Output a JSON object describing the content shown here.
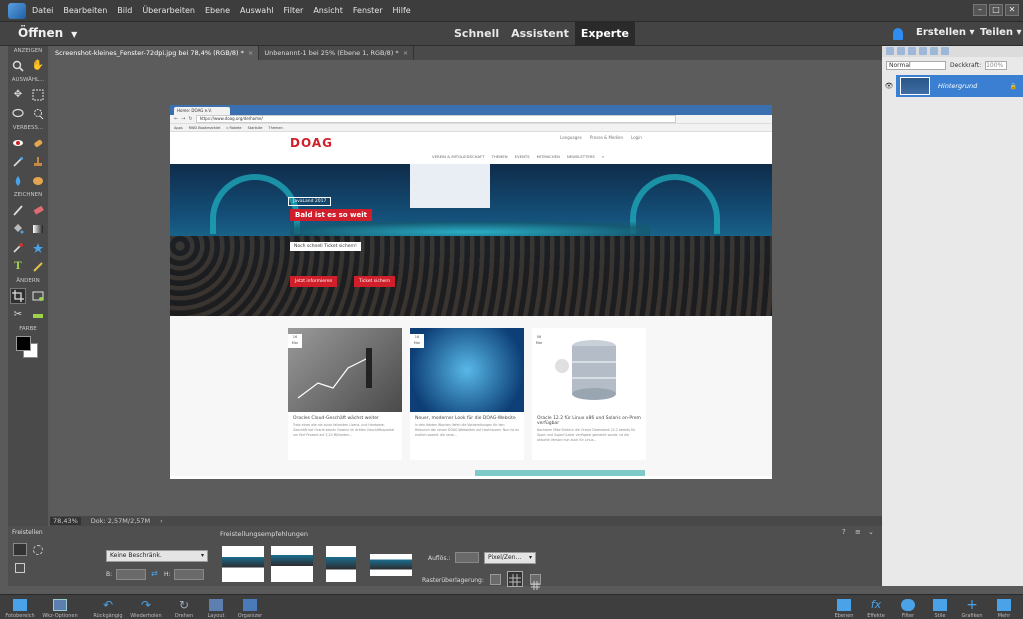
{
  "menu": [
    "Datei",
    "Bearbeiten",
    "Bild",
    "Überarbeiten",
    "Ebene",
    "Auswahl",
    "Filter",
    "Ansicht",
    "Fenster",
    "Hilfe"
  ],
  "modebar": {
    "open_label": "Öffnen",
    "modes": [
      "Schnell",
      "Assistent",
      "Experte"
    ],
    "active_mode": "Experte",
    "create_label": "Erstellen",
    "share_label": "Teilen"
  },
  "tabs": [
    {
      "label": "Screenshot-kleines_Fenster-72dpi.jpg bei 78,4% (RGB/8) *",
      "active": true
    },
    {
      "label": "Unbenannt-1 bei 25% (Ebene 1, RGB/8) *",
      "active": false
    }
  ],
  "toolbox": {
    "sections": [
      "ANZEIGEN",
      "AUSWÄHL...",
      "VERBESS...",
      "ZEICHNEN",
      "ÄNDERN",
      "FARBE"
    ]
  },
  "status": {
    "zoom": "78,43%",
    "doc": "Dok: 2,57M/2,57M"
  },
  "layers": {
    "blend_mode": "Normal",
    "opacity_label": "Deckkraft:",
    "opacity_value": "100%",
    "layer_name": "Hintergrund"
  },
  "crop_panel": {
    "title": "Freistellen",
    "suggestions_title": "Freistellungsempfehlungen",
    "constraint": "Keine Beschränk.",
    "b_label": "B:",
    "h_label": "H:",
    "res_label": "Auflös.:",
    "res_unit": "Pixel/Zen...",
    "grid_label": "Rasterüberlagerung:"
  },
  "taskbar_left": [
    "Fotobereich",
    "Wkz-Optionen",
    "Rückgängig",
    "Wiederholen",
    "Drehen",
    "Layout",
    "Organizer"
  ],
  "taskbar_right": [
    "Ebenen",
    "Effekte",
    "Filter",
    "Stile",
    "Grafiken",
    "Mehr"
  ],
  "webpage": {
    "browser_tab": "Home: DOAG e.V.",
    "url": "https://www.doag.org/de/home/",
    "bookmarks": [
      "Apps",
      "RWD Bookmarklet",
      "c Rakete",
      "Startsite",
      "Themen"
    ],
    "toplinks": [
      "Languages",
      "Presse & Medien",
      "Login"
    ],
    "logo": "DOAG",
    "nav": [
      "VEREIN & MITGLIEDSCHAFT",
      "THEMEN",
      "EVENTS",
      "MITMACHEN",
      "NEWSLETTERS"
    ],
    "hero_tag": "JavaLand 2017",
    "hero_title": "Bald ist es so weit",
    "hero_sub": "Noch schnell Ticket sichern!",
    "btn_info": "Jetzt informieren",
    "btn_ticket": "Ticket sichern",
    "cards": [
      {
        "day": "16",
        "mon": "Mar",
        "title": "Oracles Cloud-Geschäft wächst weiter",
        "text": "Trotz eines wie nie zuvor fallenden Lizenz- und Hardware-Geschäft hat Oracle seinen Gewinn im dritten Geschäftsquartal um fünf Prozent auf 2,24 Milliarden..."
      },
      {
        "day": "16",
        "mon": "Mar",
        "title": "Neuer, moderner Look für die DOAG-Website",
        "text": "In den letzten Wochen liefen die Vorbereitungen für den Relaunch der neuen DOAG-Webseiten auf Hochtouren. Nun ist es endlich soweit: die neue..."
      },
      {
        "day": "06",
        "mon": "Mar",
        "title": "Oracle 12.2 für Linux x86 und Solaris on-Prem verfügbar",
        "text": "Nachdem Mike Dietrich die Oracle Datenbank 12.2 bereits für Sparc und SuperCluster verfügbar gemacht wurde, ist die aktuelle Version nun auch für Linux..."
      }
    ]
  },
  "colors": {
    "accent": "#3b7fd3",
    "doag_red": "#d01f2a",
    "hero_teal": "#1ea7b9"
  }
}
